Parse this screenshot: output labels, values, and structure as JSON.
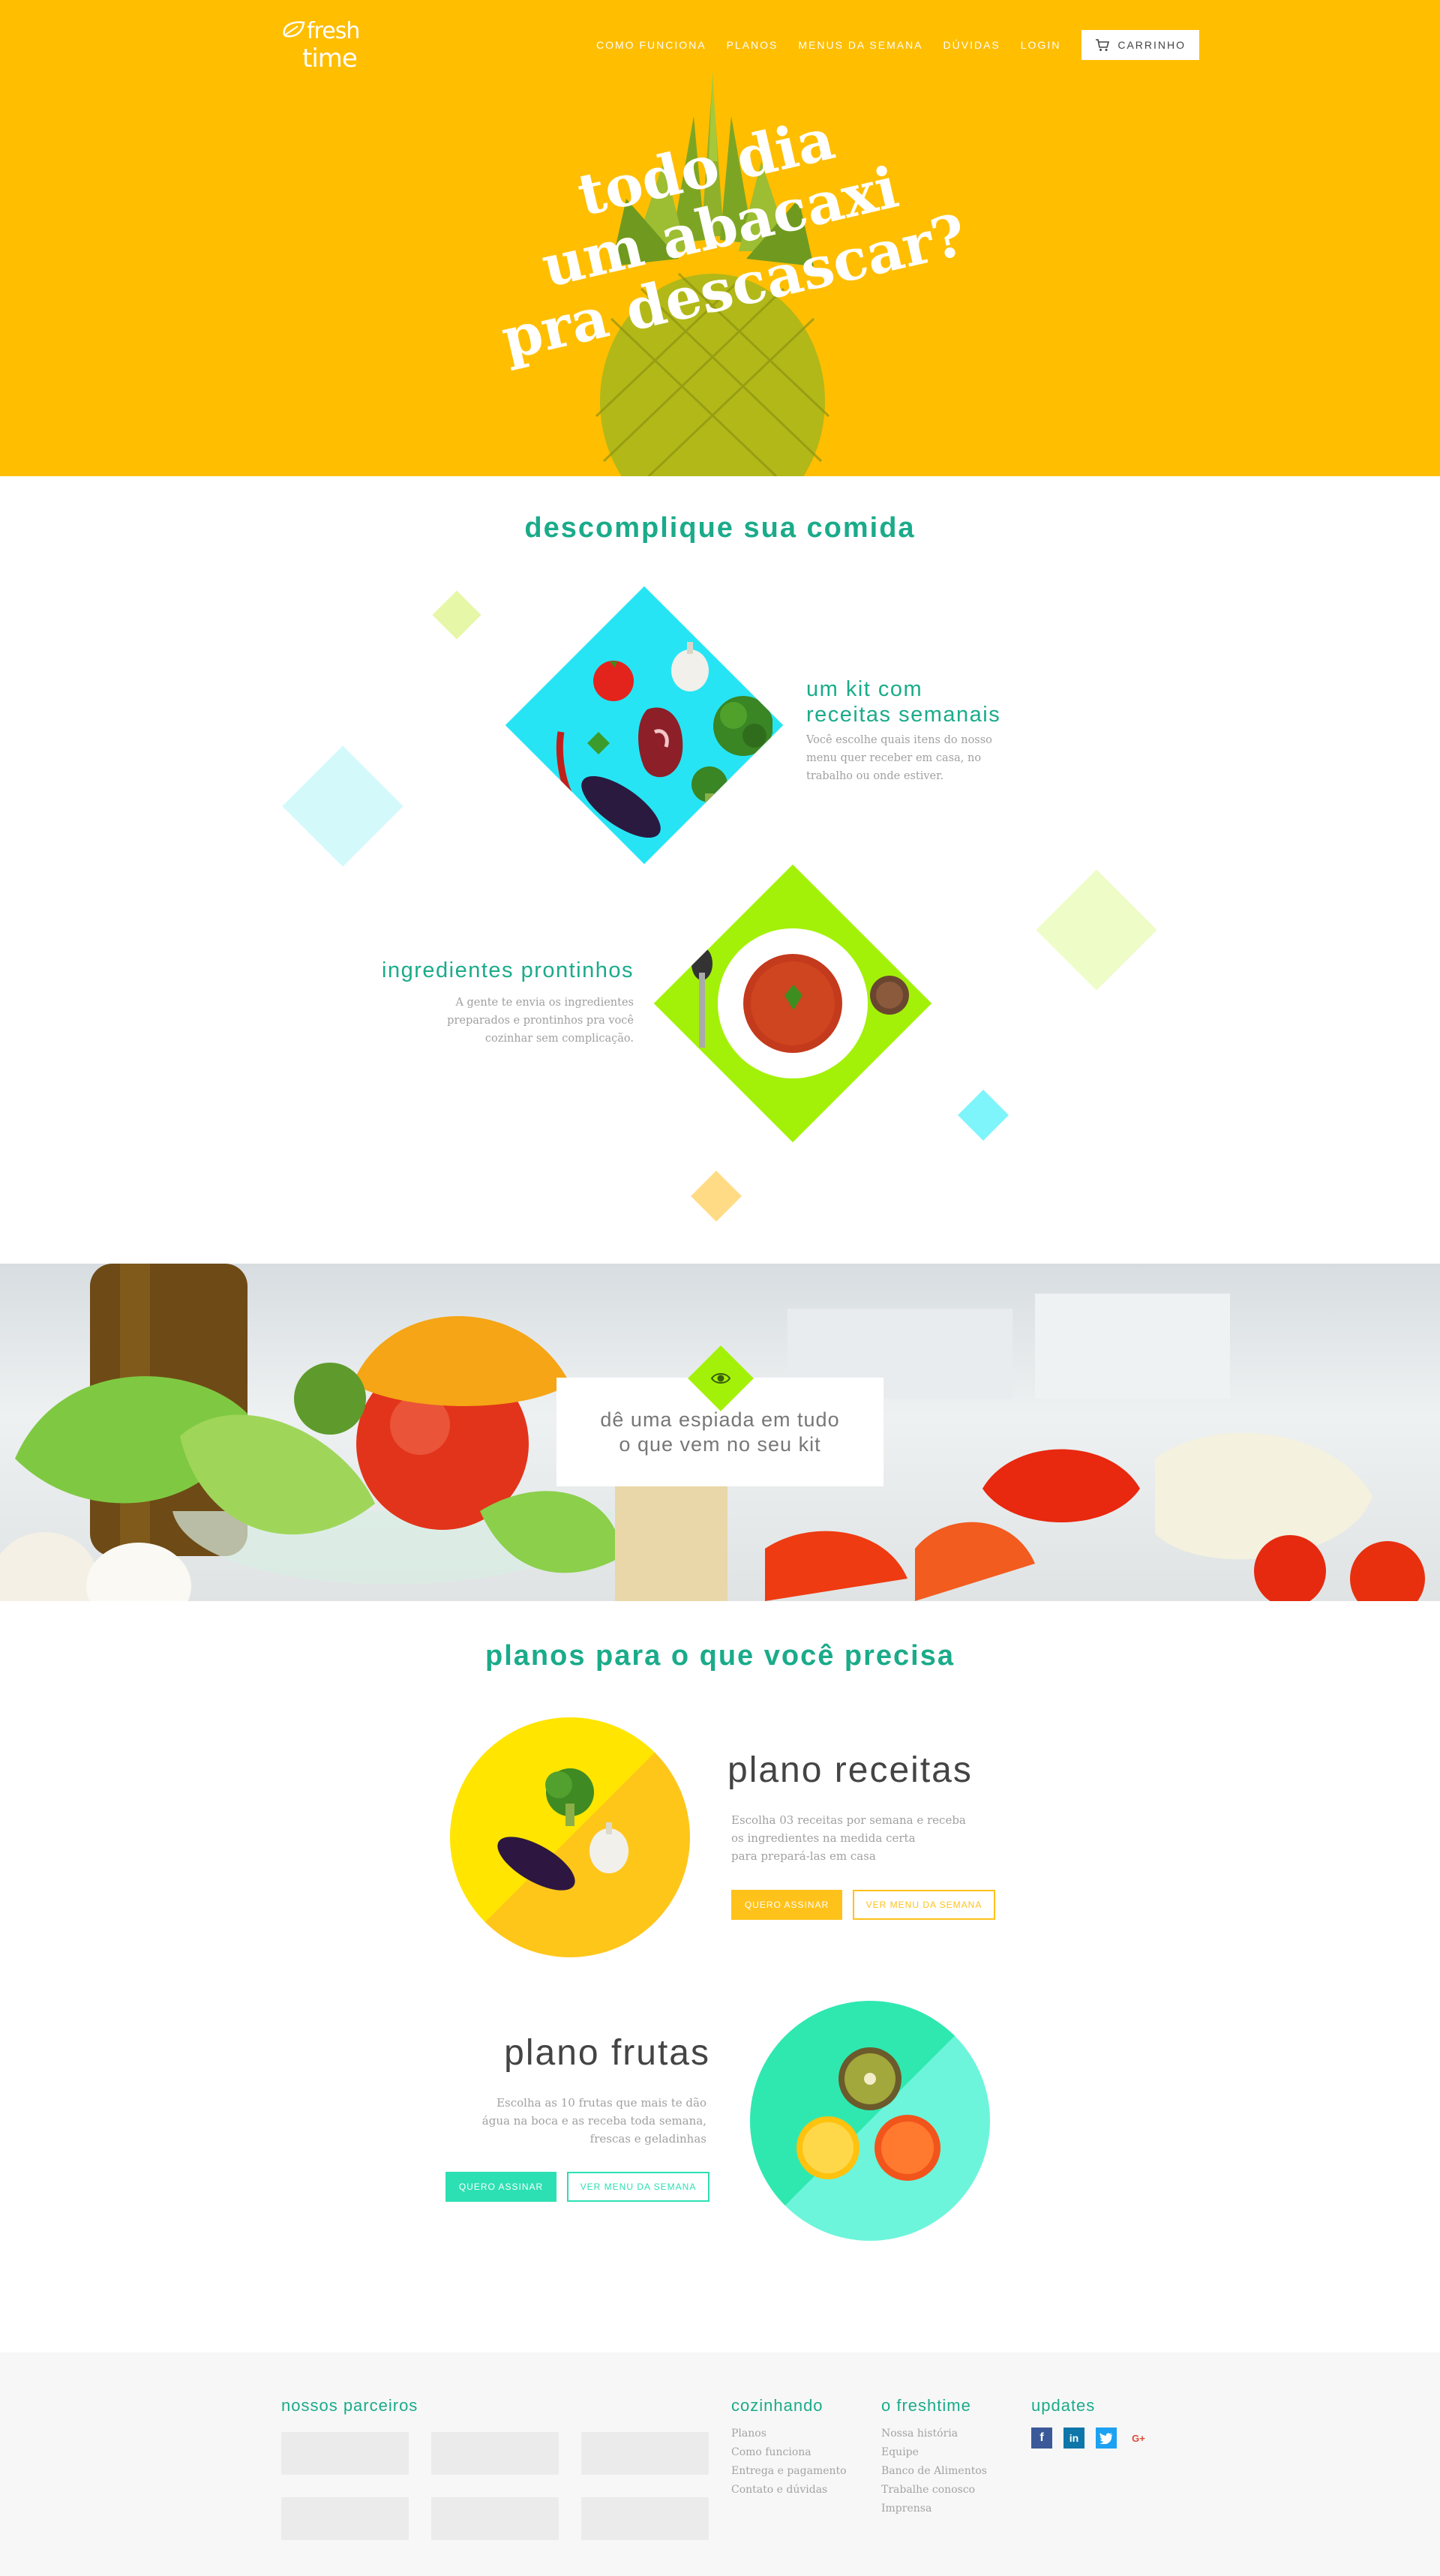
{
  "brand": {
    "logo_line1": "fresh",
    "logo_line2": "time"
  },
  "nav": {
    "items": [
      "COMO FUNCIONA",
      "PLANOS",
      "MENUS DA SEMANA",
      "DÚVIDAS",
      "LOGIN"
    ],
    "cart_label": "CARRINHO"
  },
  "hero": {
    "lines": [
      "todo dia",
      "um abacaxi",
      "pra descascar?"
    ]
  },
  "features": {
    "title": "descomplique sua comida",
    "items": [
      {
        "title_lines": [
          "um kit com",
          "receitas semanais"
        ],
        "text_lines": [
          "Você escolhe quais itens do nosso",
          "menu quer receber em casa, no",
          "trabalho ou onde estiver."
        ]
      },
      {
        "title_lines": [
          "ingredientes prontinhos"
        ],
        "text_lines": [
          "A gente te envia os ingredientes",
          "preparados e prontinhos pra você",
          "cozinhar sem complicação."
        ]
      }
    ]
  },
  "banner": {
    "text_lines": [
      "dê uma espiada em tudo",
      "o que vem no seu kit"
    ]
  },
  "plans": {
    "title": "planos para o que você precisa",
    "items": [
      {
        "name": "plano receitas",
        "text_lines": [
          "Escolha 03 receitas por semana e receba",
          "os ingredientes na medida certa",
          "para prepará-las em casa"
        ],
        "subscribe_label": "QUERO ASSINAR",
        "menu_label": "VER MENU DA SEMANA",
        "color": "#ffc21a"
      },
      {
        "name": "plano frutas",
        "text_lines": [
          "Escolha as 10 frutas que mais te dão",
          "água na boca e as receba toda semana,",
          "frescas e geladinhas"
        ],
        "subscribe_label": "QUERO ASSINAR",
        "menu_label": "VER MENU DA SEMANA",
        "color": "#2de0b3"
      }
    ]
  },
  "footer": {
    "partners_title": "nossos parceiros",
    "cooking": {
      "title": "cozinhando",
      "links": [
        "Planos",
        "Como funciona",
        "Entrega e pagamento",
        "Contato e dúvidas"
      ]
    },
    "about": {
      "title": "o freshtime",
      "links": [
        "Nossa história",
        "Equipe",
        "Banco de Alimentos",
        "Trabalhe conosco",
        "Imprensa"
      ]
    },
    "updates": {
      "title": "updates",
      "social": [
        "facebook-icon",
        "linkedin-icon",
        "twitter-icon",
        "google-plus-icon"
      ]
    }
  },
  "colors": {
    "hero_bg": "#ffbe00",
    "accent": "#1aab8a",
    "yellow": "#ffc21a",
    "mint": "#2de0b3"
  }
}
